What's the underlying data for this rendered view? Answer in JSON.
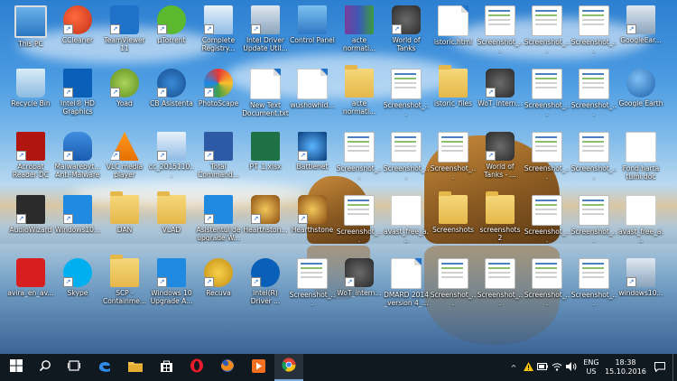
{
  "taskbar": {
    "lang": "ENG",
    "region": "US",
    "time": "18:38",
    "date": "15.10.2016",
    "show_hidden_icon": "^"
  },
  "desktop": {
    "icons": [
      {
        "label": "This PC",
        "icon": "computer-icon"
      },
      {
        "label": "CCleaner",
        "icon": "ccleaner-icon"
      },
      {
        "label": "TeamViewer 11",
        "icon": "teamviewer-icon"
      },
      {
        "label": "µTorrent",
        "icon": "utorrent-icon"
      },
      {
        "label": "Complete Registry...",
        "icon": "registry-icon"
      },
      {
        "label": "Intel Driver Update Util...",
        "icon": "installer-icon"
      },
      {
        "label": "Control Panel",
        "icon": "control-panel-icon"
      },
      {
        "label": "acte normati...",
        "icon": "winrar-icon"
      },
      {
        "label": "World of Tanks",
        "icon": "wot-icon"
      },
      {
        "label": "istoric.html",
        "icon": "html-file-icon"
      },
      {
        "label": "Screenshot_...",
        "icon": "screenshot-icon"
      },
      {
        "label": "Screenshot_...",
        "icon": "screenshot-icon"
      },
      {
        "label": "Screenshot_...",
        "icon": "screenshot-icon"
      },
      {
        "label": "GoogleEar...",
        "icon": "installer-icon"
      },
      {
        "label": "Recycle Bin",
        "icon": "recycle-bin-icon"
      },
      {
        "label": "Intel® HD Graphics Co...",
        "icon": "intel-graphics-icon"
      },
      {
        "label": "Yoad",
        "icon": "yoad-icon"
      },
      {
        "label": "CB Asistenta",
        "icon": "teamviewer-qs-icon"
      },
      {
        "label": "PhotoScape",
        "icon": "photoscape-icon"
      },
      {
        "label": "New Text Document.txt",
        "icon": "text-file-icon"
      },
      {
        "label": "wushowhid...",
        "icon": "file-icon"
      },
      {
        "label": "acte normati...",
        "icon": "folder-icon"
      },
      {
        "label": "Screenshot_...",
        "icon": "screenshot-icon"
      },
      {
        "label": "istoric_files",
        "icon": "folder-icon"
      },
      {
        "label": "WoT_intern...",
        "icon": "wot-icon"
      },
      {
        "label": "Screenshot_...",
        "icon": "screenshot-icon"
      },
      {
        "label": "Screenshot_...",
        "icon": "screenshot-icon"
      },
      {
        "label": "Google Earth",
        "icon": "google-earth-icon"
      },
      {
        "label": "Acrobat Reader DC",
        "icon": "acrobat-icon"
      },
      {
        "label": "Malwarebyt... Anti-Malware",
        "icon": "malwarebytes-icon"
      },
      {
        "label": "VLC media player",
        "icon": "vlc-icon"
      },
      {
        "label": "cc_2015110...",
        "icon": "registry-icon"
      },
      {
        "label": "Total Command...",
        "icon": "floppy-icon"
      },
      {
        "label": "PT_1.xlsx",
        "icon": "excel-icon"
      },
      {
        "label": "Battlenet",
        "icon": "battlenet-icon"
      },
      {
        "label": "Screenshot_...",
        "icon": "screenshot-icon"
      },
      {
        "label": "Screenshot_...",
        "icon": "screenshot-icon"
      },
      {
        "label": "Screenshot_...",
        "icon": "screenshot-icon"
      },
      {
        "label": "World of Tanks - ...",
        "icon": "wot-icon"
      },
      {
        "label": "Screenshot_...",
        "icon": "screenshot-icon"
      },
      {
        "label": "Screenshot_...",
        "icon": "screenshot-icon"
      },
      {
        "label": "Fond harta tumi.doc",
        "icon": "word-icon"
      },
      {
        "label": "AudioWizard",
        "icon": "audiowizard-icon"
      },
      {
        "label": "Windows10...",
        "icon": "windows-icon"
      },
      {
        "label": "DAN",
        "icon": "folder-icon"
      },
      {
        "label": "VLAD",
        "icon": "folder-icon"
      },
      {
        "label": "Asistentul de upgrade W...",
        "icon": "windows-icon"
      },
      {
        "label": "Hearthston...",
        "icon": "hearthstone-icon"
      },
      {
        "label": "Hearthstone",
        "icon": "hearthstone-icon"
      },
      {
        "label": "Screenshot_...",
        "icon": "screenshot-icon"
      },
      {
        "label": "avast_free_a...",
        "icon": "avast-icon"
      },
      {
        "label": "Screenshots",
        "icon": "folder-icon"
      },
      {
        "label": "screenshots 2",
        "icon": "folder-icon"
      },
      {
        "label": "Screenshot_...",
        "icon": "screenshot-icon"
      },
      {
        "label": "Screenshot_...",
        "icon": "screenshot-icon"
      },
      {
        "label": "avast_free_a...",
        "icon": "avast-icon"
      },
      {
        "label": "avira_en_av...",
        "icon": "avira-icon"
      },
      {
        "label": "Skype",
        "icon": "skype-icon"
      },
      {
        "label": "SCP - Containme...",
        "icon": "folder-icon"
      },
      {
        "label": "Windows 10 Upgrade A...",
        "icon": "windows-icon"
      },
      {
        "label": "Recuva",
        "icon": "recuva-icon"
      },
      {
        "label": "Intel(R) Driver ...",
        "icon": "intel-driver-icon"
      },
      {
        "label": "Screenshot_...",
        "icon": "screenshot-icon"
      },
      {
        "label": "WoT_intern...",
        "icon": "wot-icon"
      },
      {
        "label": "DMARD 2014 _version 4_...",
        "icon": "pdf-icon"
      },
      {
        "label": "Screenshot_...",
        "icon": "screenshot-icon"
      },
      {
        "label": "Screenshot_...",
        "icon": "screenshot-icon"
      },
      {
        "label": "Screenshot_...",
        "icon": "screenshot-icon"
      },
      {
        "label": "Screenshot_...",
        "icon": "screenshot-icon"
      },
      {
        "label": "windows10...",
        "icon": "installer-icon"
      }
    ]
  },
  "colors": {
    "taskbar": "#101820",
    "accent": "#1f72c8"
  }
}
